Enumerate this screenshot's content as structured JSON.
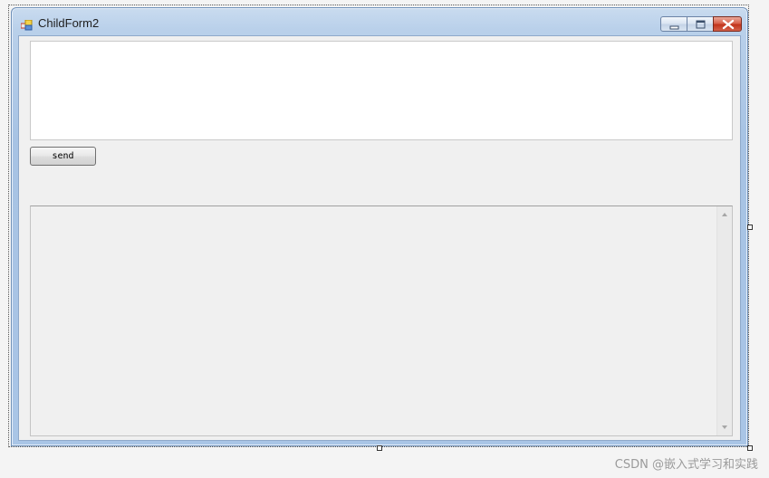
{
  "window": {
    "title": "ChildForm2",
    "caption_buttons": {
      "minimize_icon": "minimize-icon",
      "maximize_icon": "maximize-icon",
      "close_icon": "close-icon"
    }
  },
  "form": {
    "message_input": {
      "value": "",
      "placeholder": ""
    },
    "send_label": "send",
    "log_text": ""
  },
  "watermark": "CSDN @嵌入式学习和实践",
  "colors": {
    "frame": "#a9c5e6",
    "client": "#f0f0f0",
    "close_button": "#c2351d"
  }
}
